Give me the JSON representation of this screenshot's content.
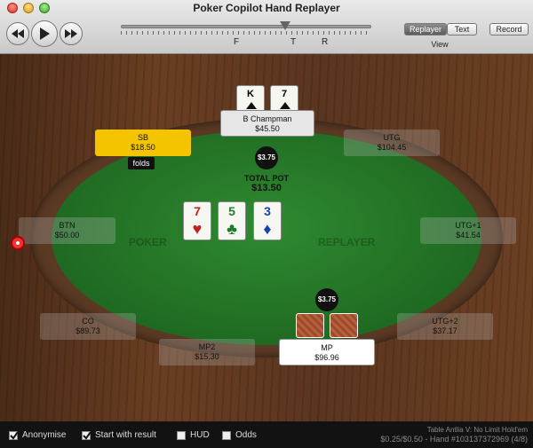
{
  "window": {
    "title": "Poker Copilot Hand Replayer"
  },
  "toolbar": {
    "rewind_icon": "rewind-icon",
    "play_icon": "play-icon",
    "forward_icon": "fast-forward-icon",
    "streets": [
      "F",
      "T",
      "R"
    ],
    "view_tabs": [
      {
        "label": "Replayer",
        "active": true
      },
      {
        "label": "Text",
        "active": false
      }
    ],
    "view_label": "View",
    "record_label": "Record"
  },
  "table": {
    "watermark_left": "POKER",
    "watermark_right": "REPLAYER",
    "pot": {
      "label": "TOTAL POT",
      "value": "$13.50"
    },
    "bets": {
      "center": "$3.75",
      "hero": "$3.75"
    },
    "board": [
      {
        "rank": "7",
        "suit": "♥",
        "color": "#c0201f"
      },
      {
        "rank": "5",
        "suit": "♣",
        "color": "#1f7a30"
      },
      {
        "rank": "3",
        "suit": "♦",
        "color": "#1a3fb3"
      }
    ],
    "villain_cards": [
      {
        "rank": "K"
      },
      {
        "rank": "7"
      }
    ],
    "seats": {
      "champ": {
        "name": "B Champman",
        "stack": "$45.50"
      },
      "sb": {
        "name": "SB",
        "stack": "$18.50",
        "action": "folds"
      },
      "utg": {
        "name": "UTG",
        "stack": "$104.45"
      },
      "btn": {
        "name": "BTN",
        "stack": "$50.00"
      },
      "utg1": {
        "name": "UTG+1",
        "stack": "$41.54"
      },
      "co": {
        "name": "CO",
        "stack": "$89.73"
      },
      "utg2": {
        "name": "UTG+2",
        "stack": "$37.17"
      },
      "mp2": {
        "name": "MP2",
        "stack": "$15.30"
      },
      "mp": {
        "name": "MP",
        "stack": "$96.96"
      }
    }
  },
  "footer": {
    "checkboxes": [
      {
        "label": "Anonymise",
        "checked": true
      },
      {
        "label": "Start with result",
        "checked": true
      },
      {
        "label": "HUD",
        "checked": false
      },
      {
        "label": "Odds",
        "checked": false
      }
    ],
    "table_info": "Table Antlia V: No Limit Hold'em",
    "hand_info": "$0.25/$0.50 - Hand #103137372969 (4/8)"
  }
}
